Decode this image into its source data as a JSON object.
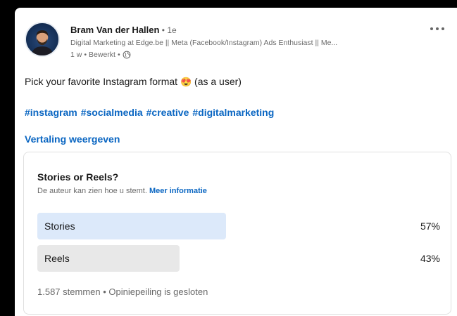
{
  "post": {
    "author_name": "Bram Van der Hallen",
    "author_degree": " • 1e",
    "headline": "Digital Marketing at Edge.be || Meta (Facebook/Instagram) Ads Enthusiast || Me...",
    "time": "1 w",
    "edited": "Bewerkt",
    "separator": "•",
    "more_options_icon": "ellipsis-icon",
    "visibility_icon": "globe-icon",
    "text_before": "Pick your favorite Instagram format ",
    "emoji": "😍",
    "text_after": " (as a user)",
    "hashtags": [
      "#instagram",
      "#socialmedia",
      "#creative",
      "#digitalmarketing"
    ],
    "translate_label": "Vertaling weergeven"
  },
  "poll": {
    "question": "Stories or Reels?",
    "note": "De auteur kan zien hoe u stemt.",
    "more_info": "Meer informatie",
    "options": [
      {
        "label": "Stories",
        "percent_label": "57%",
        "percent": 57,
        "selected": true
      },
      {
        "label": "Reels",
        "percent_label": "43%",
        "percent": 43,
        "selected": false
      }
    ],
    "footer": "1.587 stemmen • Opiniepeiling is gesloten"
  },
  "colors": {
    "link_blue": "#0a66c2",
    "selected_bar": "#dce9fa",
    "other_bar": "#e8e8e8",
    "background": "#000000"
  }
}
